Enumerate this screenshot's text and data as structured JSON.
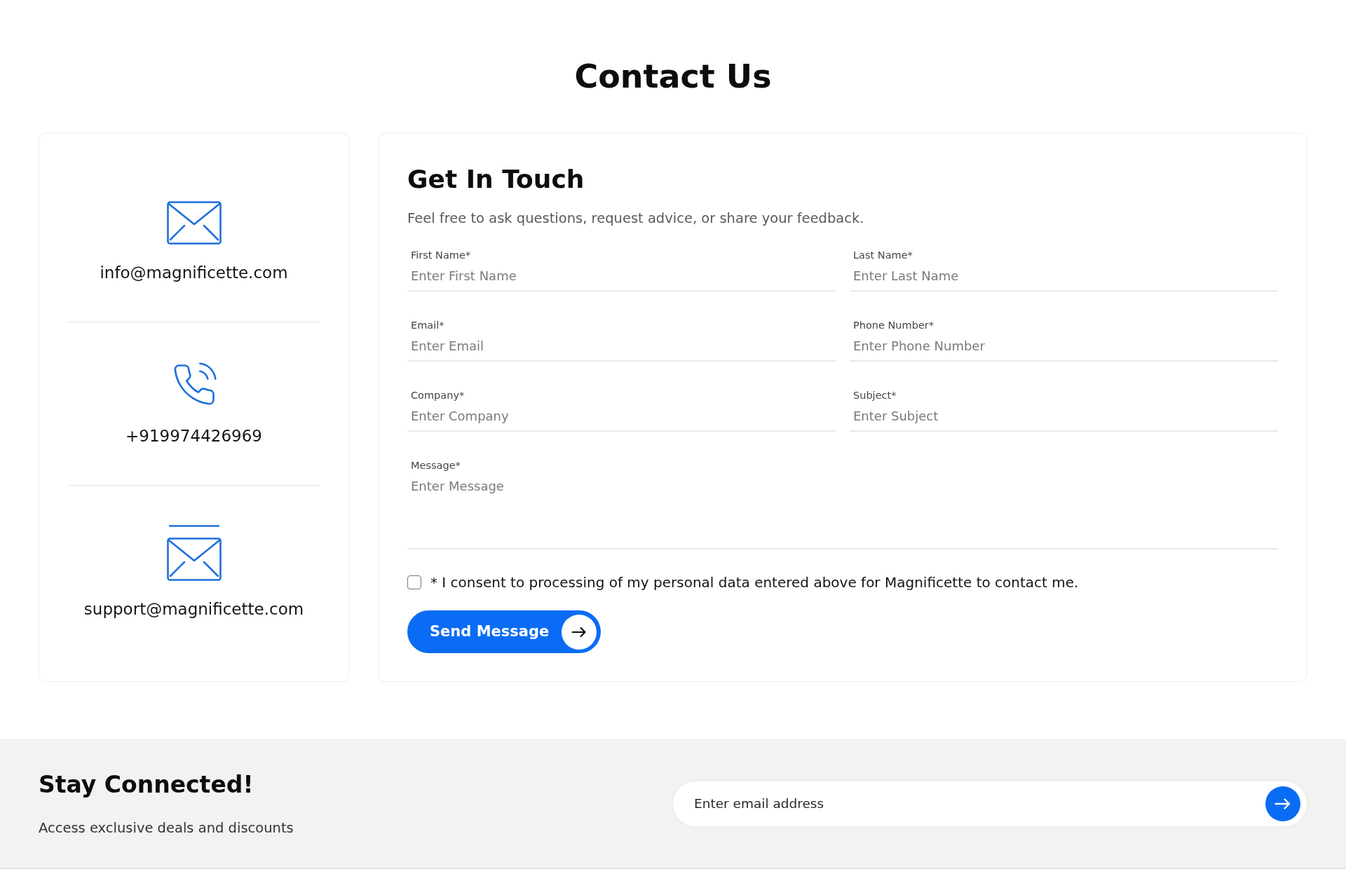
{
  "page_title": "Contact Us",
  "contact_items": [
    {
      "kind": "email",
      "text": "info@magnificette.com"
    },
    {
      "kind": "phone",
      "text": "+919974426969"
    },
    {
      "kind": "support",
      "text": "support@magnificette.com"
    }
  ],
  "form": {
    "title": "Get In Touch",
    "subtitle": "Feel free to ask questions, request advice, or share your feedback.",
    "fields": [
      {
        "kind": "text",
        "label": "First Name*",
        "placeholder": "Enter First Name"
      },
      {
        "kind": "text",
        "label": "Last Name*",
        "placeholder": "Enter Last Name"
      },
      {
        "kind": "text",
        "label": "Email*",
        "placeholder": "Enter Email"
      },
      {
        "kind": "text",
        "label": "Phone Number*",
        "placeholder": "Enter Phone Number"
      },
      {
        "kind": "text",
        "label": "Company*",
        "placeholder": "Enter Company"
      },
      {
        "kind": "text",
        "label": "Subject*",
        "placeholder": "Enter Subject"
      },
      {
        "kind": "textarea",
        "label": "Message*",
        "placeholder": "Enter Message"
      }
    ],
    "consent": {
      "label": "* I consent to processing of my personal data entered above for Magnificette to contact me.",
      "checked": false
    },
    "submit_button": {
      "label": "Send Message"
    }
  },
  "newsletter": {
    "title": "Stay Connected!",
    "subtitle": "Access exclusive deals and discounts",
    "email_field": {
      "placeholder": "Enter email address"
    }
  }
}
